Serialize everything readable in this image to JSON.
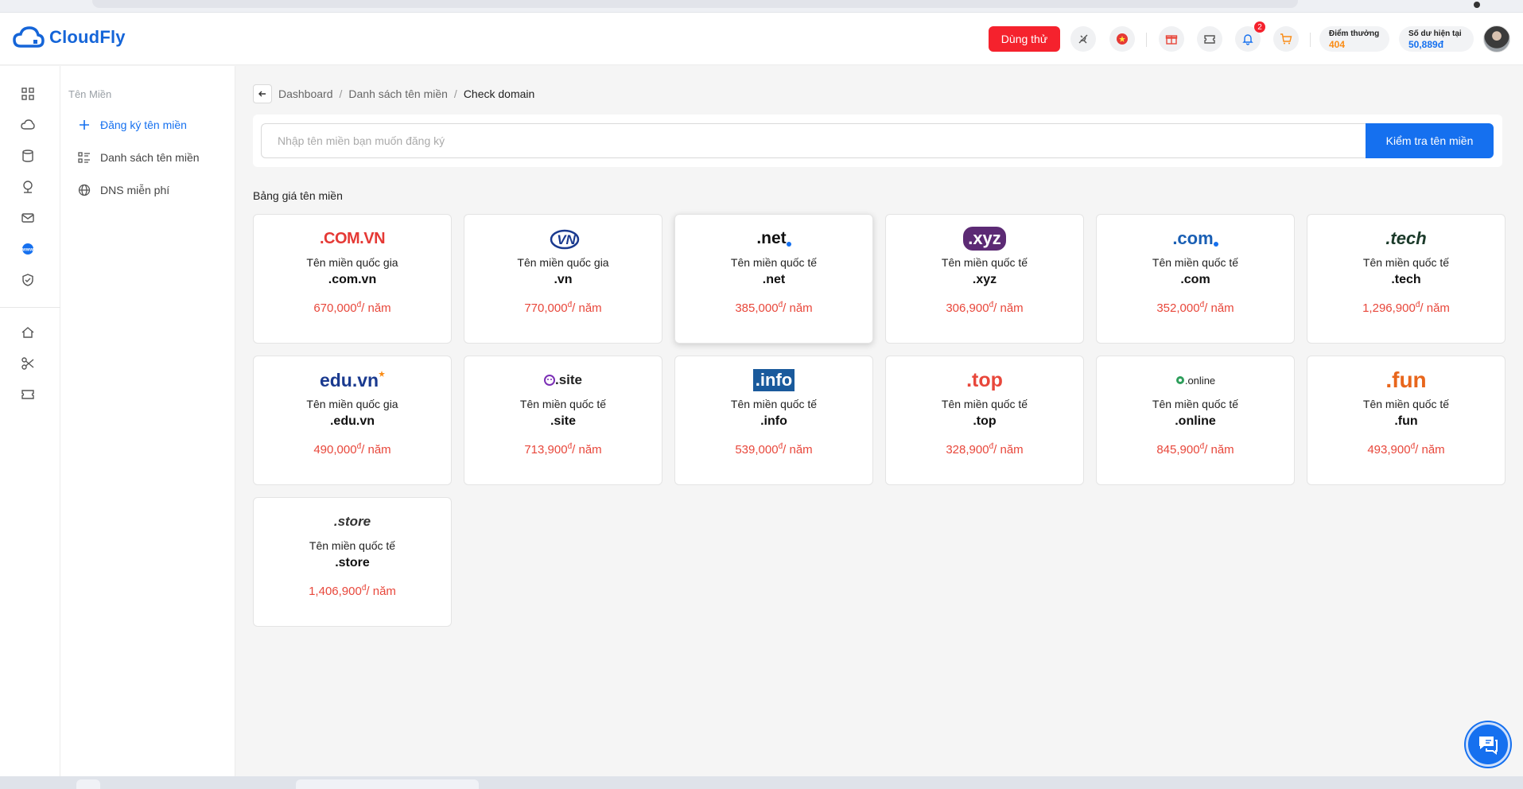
{
  "header": {
    "logo_text": "CloudFly",
    "trial_label": "Dùng thử",
    "notification_count": "2",
    "points_label": "Điểm thưởng",
    "points_value": "404",
    "balance_label": "Số dư hiện tại",
    "balance_value": "50,889đ"
  },
  "rail": {
    "icons": [
      "dashboard-icon",
      "cloud-icon",
      "storage-icon",
      "network-icon",
      "mail-icon",
      "domain-icon",
      "shield-icon",
      "home-icon",
      "scissors-icon",
      "ticket-icon"
    ]
  },
  "subnav": {
    "title": "Tên Miền",
    "items": [
      {
        "label": "Đăng ký tên miền",
        "icon": "plus-icon"
      },
      {
        "label": "Danh sách tên miền",
        "icon": "list-icon"
      },
      {
        "label": "DNS miễn phí",
        "icon": "globe-icon"
      }
    ]
  },
  "breadcrumb": {
    "items": [
      "Dashboard",
      "Danh sách tên miền",
      "Check domain"
    ]
  },
  "search": {
    "placeholder": "Nhập tên miền bạn muốn đăng ký",
    "value": "",
    "button_label": "Kiểm tra tên miền"
  },
  "price_table": {
    "title": "Bảng giá tên miền",
    "unit": "đ",
    "per": "/ năm",
    "cards": [
      {
        "logo": ".COM.VN",
        "type": "Tên miền quốc gia",
        "ext": ".com.vn",
        "price": "670,000"
      },
      {
        "logo": "VN",
        "type": "Tên miền quốc gia",
        "ext": ".vn",
        "price": "770,000"
      },
      {
        "logo": ".net",
        "type": "Tên miền quốc tế",
        "ext": ".net",
        "price": "385,000"
      },
      {
        "logo": ".xyz",
        "type": "Tên miền quốc tế",
        "ext": ".xyz",
        "price": "306,900"
      },
      {
        "logo": ".com",
        "type": "Tên miền quốc tế",
        "ext": ".com",
        "price": "352,000"
      },
      {
        "logo": ".tech",
        "type": "Tên miền quốc tế",
        "ext": ".tech",
        "price": "1,296,900"
      },
      {
        "logo": "edu.vn",
        "type": "Tên miền quốc gia",
        "ext": ".edu.vn",
        "price": "490,000"
      },
      {
        "logo": ".site",
        "type": "Tên miền quốc tế",
        "ext": ".site",
        "price": "713,900"
      },
      {
        "logo": ".info",
        "type": "Tên miền quốc tế",
        "ext": ".info",
        "price": "539,000"
      },
      {
        "logo": ".top",
        "type": "Tên miền quốc tế",
        "ext": ".top",
        "price": "328,900"
      },
      {
        "logo": ".online",
        "type": "Tên miền quốc tế",
        "ext": ".online",
        "price": "845,900"
      },
      {
        "logo": ".fun",
        "type": "Tên miền quốc tế",
        "ext": ".fun",
        "price": "493,900"
      },
      {
        "logo": ".store",
        "type": "Tên miền quốc tế",
        "ext": ".store",
        "price": "1,406,900"
      }
    ]
  },
  "colors": {
    "primary": "#1570ef",
    "trial_red": "#f5222d",
    "price_red": "#e8473b",
    "points_orange": "#fa8c16"
  }
}
